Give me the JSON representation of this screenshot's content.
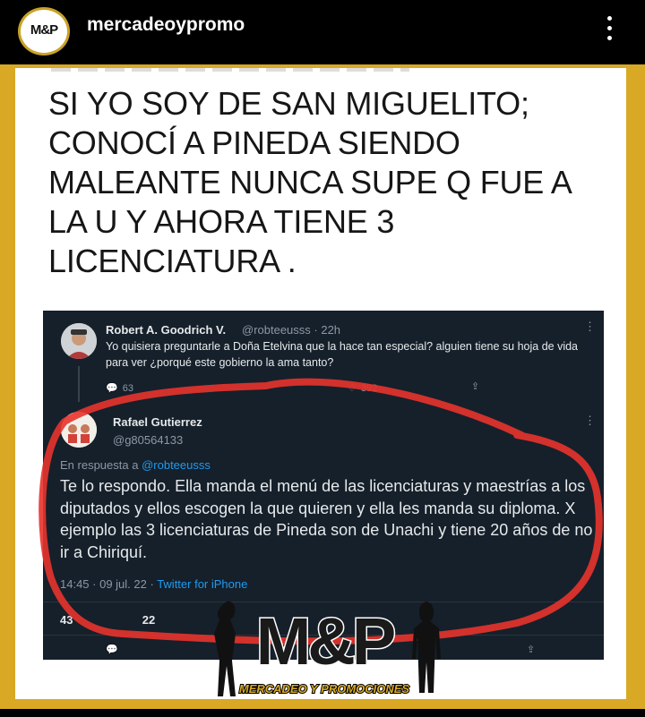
{
  "header": {
    "username": "mercadeoypromo",
    "avatar_text": "M&P"
  },
  "headline": "SI YO SOY DE SAN MIGUELITO; CONOCÍ A PINEDA SIENDO MALEANTE NUNCA SUPE Q FUE A LA U Y AHORA TIENE 3 LICENCIATURA .",
  "tweet1": {
    "name": "Robert A. Goodrich V.",
    "handle": "@robteeusss · 22h",
    "text": "Yo quisiera preguntarle a Doña Etelvina que la hace tan especial? alguien tiene su hoja de vida para ver ¿porqué este gobierno la ama tanto?",
    "replies": "63",
    "likes": "392"
  },
  "tweet2": {
    "name": "Rafael Gutierrez",
    "handle": "@g80564133",
    "reply_prefix": "En respuesta a",
    "reply_handle": "@robteeusss",
    "text": "Te lo respondo. Ella manda el menú de las licenciaturas y maestrías a los diputados y ellos escogen la que quieren y ella les manda su diploma. X ejemplo las 3 licenciaturas de Pineda son de Unachi y tiene 20 años de no ir a Chiriquí.",
    "time": "14:45 · 09 jul. 22 ·",
    "source": "Twitter for iPhone",
    "stat1_num": "43",
    "stat2_num": "22"
  },
  "watermark": {
    "logo": "M&P",
    "tagline": "MERCADEO Y PROMOCIONES"
  },
  "colors": {
    "frame_gold": "#d9a925",
    "tweet_bg": "#15202b",
    "link_blue": "#1d9bf0",
    "annotation_red": "#e8332c"
  }
}
